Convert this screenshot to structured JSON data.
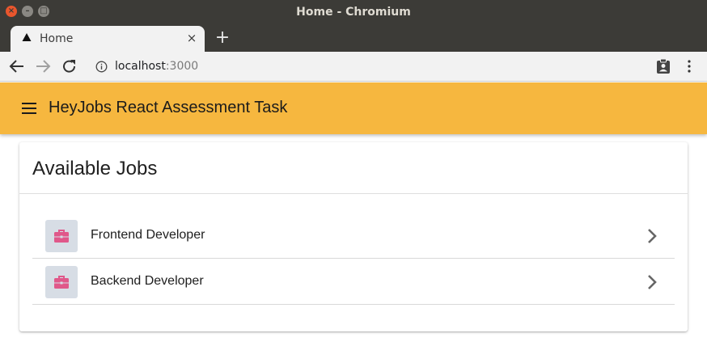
{
  "window": {
    "title": "Home - Chromium",
    "controls": {
      "close": "×",
      "minimize": "–",
      "maximize": "□"
    }
  },
  "tab": {
    "title": "Home",
    "close_label": "×",
    "new_tab_label": "+"
  },
  "toolbar": {
    "url_host": "localhost",
    "url_port": ":3000"
  },
  "appbar": {
    "title": "HeyJobs React Assessment Task"
  },
  "card": {
    "title": "Available Jobs"
  },
  "jobs": [
    {
      "title": "Frontend Developer"
    },
    {
      "title": "Backend Developer"
    }
  ],
  "icons": {
    "job": "briefcase-icon",
    "chevron": "chevron-right-icon",
    "menu": "hamburger-menu-icon"
  },
  "colors": {
    "appbar": "#f6b73f",
    "briefcase": "#e0588a",
    "avatar_bg": "#d7dde5",
    "titlebar": "#3c3b37"
  }
}
